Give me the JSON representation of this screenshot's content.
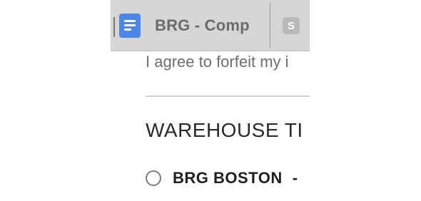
{
  "tabs": [
    {
      "title": "BRG - Comp",
      "icon": "google-docs-icon"
    },
    {
      "title": "S",
      "icon": "s-app-icon"
    }
  ],
  "form": {
    "consent_text": "I agree to forfeit my i",
    "section_heading": "WAREHOUSE TI",
    "options": [
      {
        "label": "BRG BOSTON",
        "suffix": "-",
        "selected": false
      }
    ]
  },
  "colors": {
    "tabbar_bg": "#d6d6d6",
    "docs_icon": "#4a86e8",
    "tab_text": "#6b6b6b",
    "body_text": "#6e6e6e",
    "heading_text": "#2a2a2a"
  }
}
